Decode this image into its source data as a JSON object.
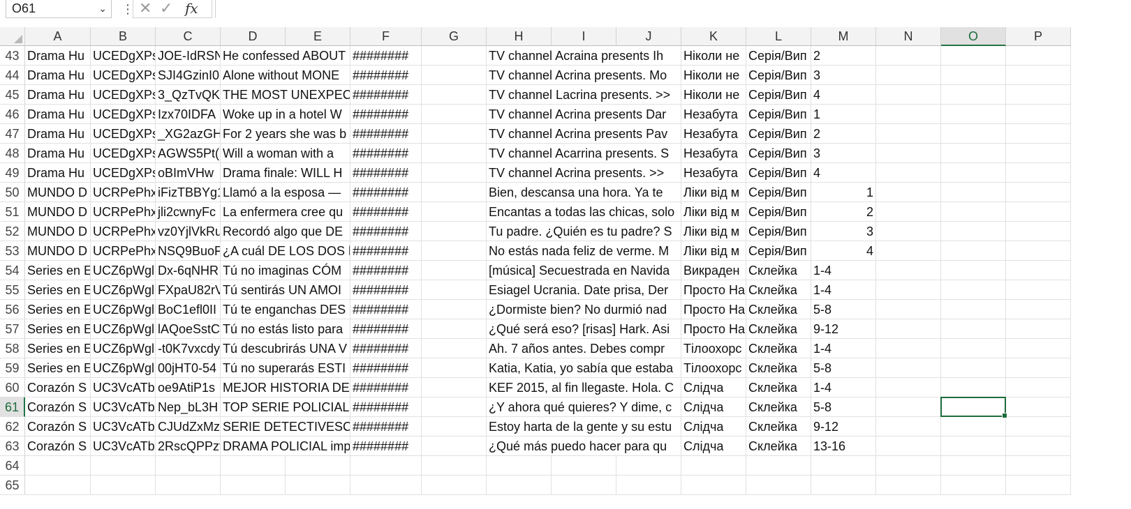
{
  "formula_bar": {
    "name_box": "O61",
    "more_icon": "⋮",
    "cancel_icon": "✕",
    "enter_icon": "✓",
    "fx_label": "fx",
    "formula": ""
  },
  "columns": [
    "A",
    "B",
    "C",
    "D",
    "E",
    "F",
    "G",
    "H",
    "I",
    "J",
    "K",
    "L",
    "M",
    "N",
    "O",
    "P"
  ],
  "active_column": "O",
  "active_row": "61",
  "rows": [
    {
      "n": "43",
      "cells": {
        "A": "Drama Hu",
        "B": "UCEDgXPs",
        "C": "JOE-IdRSN",
        "D": "He confessed ABOUT",
        "F": "########",
        "H": "TV channel Acraina presents Ih",
        "K": "Ніколи не",
        "L": "Серія/Вип",
        "M": "2"
      }
    },
    {
      "n": "44",
      "cells": {
        "A": "Drama Hu",
        "B": "UCEDgXPs",
        "C": "SJI4GzinI0",
        "D": "Alone without MONE",
        "F": "########",
        "H": "TV channel Acrina presents. Mo",
        "K": "Ніколи не",
        "L": "Серія/Вип",
        "M": "3"
      }
    },
    {
      "n": "45",
      "cells": {
        "A": "Drama Hu",
        "B": "UCEDgXPs",
        "C": "3_QzTvQK",
        "D": "THE MOST UNEXPECT",
        "F": "########",
        "H": "TV channel Lacrina presents. >>",
        "K": "Ніколи не",
        "L": "Серія/Вип",
        "M": "4"
      }
    },
    {
      "n": "46",
      "cells": {
        "A": "Drama Hu",
        "B": "UCEDgXPs",
        "C": "Izx70IDFA",
        "D": "Woke up in a hotel W",
        "F": "########",
        "H": "TV channel Acrina presents Dar",
        "K": "Незабута",
        "L": "Серія/Вип",
        "M": "1"
      }
    },
    {
      "n": "47",
      "cells": {
        "A": "Drama Hu",
        "B": "UCEDgXPs",
        "C": "_XG2azGH",
        "D": "For 2 years she was b",
        "F": "########",
        "H": "TV channel Acrina presents Pav",
        "K": "Незабута",
        "L": "Серія/Вип",
        "M": "2"
      }
    },
    {
      "n": "48",
      "cells": {
        "A": "Drama Hu",
        "B": "UCEDgXPs",
        "C": "AGWS5Pt(",
        "D": "Will a woman with a",
        "F": "########",
        "H": "TV channel Acarrina presents. S",
        "K": "Незабута",
        "L": "Серія/Вип",
        "M": "3"
      }
    },
    {
      "n": "49",
      "cells": {
        "A": "Drama Hu",
        "B": "UCEDgXPs",
        "C": "oBImVHw",
        "D": "Drama finale: WILL H",
        "F": "########",
        "H": "TV channel Acrina presents. >>",
        "K": "Незабута",
        "L": "Серія/Вип",
        "M": "4"
      }
    },
    {
      "n": "50",
      "cells": {
        "A": "MUNDO D",
        "B": "UCRPePhx",
        "C": "iFizTBBYg1",
        "D": "Llamó a la esposa —",
        "F": "########",
        "H": "Bien, descansa una hora. Ya te",
        "K": "Ліки від м",
        "L": "Серія/Вип",
        "M_num": "1"
      }
    },
    {
      "n": "51",
      "cells": {
        "A": "MUNDO D",
        "B": "UCRPePhx",
        "C": "jli2cwnyFc",
        "D": "La enfermera cree qu",
        "F": "########",
        "H": "Encantas a todas las chicas, solo",
        "K": "Ліки від м",
        "L": "Серія/Вип",
        "M_num": "2"
      }
    },
    {
      "n": "52",
      "cells": {
        "A": "MUNDO D",
        "B": "UCRPePhx",
        "C": "vz0YjlVkRu",
        "D": "Recordó algo que DE",
        "F": "########",
        "H": "Tu padre. ¿Quién es tu padre? S",
        "K": "Ліки від м",
        "L": "Серія/Вип",
        "M_num": "3"
      }
    },
    {
      "n": "53",
      "cells": {
        "A": "MUNDO D",
        "B": "UCRPePhx",
        "C": "NSQ9BuoF",
        "D": "¿A cuál DE LOS DOS h",
        "F": "########",
        "H": "No estás nada feliz de verme. M",
        "K": "Ліки від м",
        "L": "Серія/Вип",
        "M_num": "4"
      }
    },
    {
      "n": "54",
      "cells": {
        "A": "Series en E",
        "B": "UCZ6pWgl",
        "C": "Dx-6qNHR",
        "D": "Tú no imaginas CÓM",
        "F": "########",
        "H": "[música] Secuestrada en Navida",
        "K": "Викраден",
        "L": "Склейка",
        "M": "1-4"
      }
    },
    {
      "n": "55",
      "cells": {
        "A": "Series en E",
        "B": "UCZ6pWgl",
        "C": "FXpaU82rV",
        "D": "Tú sentirás UN AMOI",
        "F": "########",
        "H": "Esiagel Ucrania. Date prisa, Der",
        "K": "Просто На",
        "L": "Склейка",
        "M": "1-4"
      }
    },
    {
      "n": "56",
      "cells": {
        "A": "Series en E",
        "B": "UCZ6pWgl",
        "C": "BoC1efl0II",
        "D": "Tú te enganchas DES",
        "F": "########",
        "H": "¿Dormiste bien? No durmió nad",
        "K": "Просто На",
        "L": "Склейка",
        "M": "5-8"
      }
    },
    {
      "n": "57",
      "cells": {
        "A": "Series en E",
        "B": "UCZ6pWgl",
        "C": "lAQoeSstC",
        "D": "Tú no estás listo para",
        "F": "########",
        "H": "¿Qué será eso? [risas] Hark. Asi",
        "K": "Просто На",
        "L": "Склейка",
        "M": "9-12"
      }
    },
    {
      "n": "58",
      "cells": {
        "A": "Series en E",
        "B": "UCZ6pWgl",
        "C": "-t0K7vxcdy",
        "D": "Tú descubrirás UNA V",
        "F": "########",
        "H": "Ah. 7 años antes. Debes compr",
        "K": "Тілоохорс",
        "L": "Склейка",
        "M": "1-4"
      }
    },
    {
      "n": "59",
      "cells": {
        "A": "Series en E",
        "B": "UCZ6pWgl",
        "C": "00jHT0-54",
        "D": "Tú no superarás ESTI",
        "F": "########",
        "H": "Katia, Katia, yo sabía que estaba",
        "K": "Тілоохорс",
        "L": "Склейка",
        "M": "5-8"
      }
    },
    {
      "n": "60",
      "cells": {
        "A": "Corazón S",
        "B": "UC3VcATb",
        "C": "oe9AtiP1s",
        "D": "MEJOR HISTORIA DET",
        "F": "########",
        "H": "KEF 2015, al fin llegaste. Hola. C",
        "K": "Слідча",
        "L": "Склейка",
        "M": "1-4"
      }
    },
    {
      "n": "61",
      "cells": {
        "A": "Corazón S",
        "B": "UC3VcATb",
        "C": "Nep_bL3H",
        "D": "TOP SERIE POLICIAL c",
        "F": "########",
        "H": "¿Y ahora qué quieres? Y dime, c",
        "K": "Слідча",
        "L": "Склейка",
        "M": "5-8"
      }
    },
    {
      "n": "62",
      "cells": {
        "A": "Corazón S",
        "B": "UC3VcATb",
        "C": "CJUdZxMz",
        "D": "SERIE DETECTIVESCA",
        "F": "########",
        "H": "Estoy harta de la gente y su estu",
        "K": "Слідча",
        "L": "Склейка",
        "M": "9-12"
      }
    },
    {
      "n": "63",
      "cells": {
        "A": "Corazón S",
        "B": "UC3VcATb",
        "C": "2RscQPPzf",
        "D": "DRAMA POLICIAL imp",
        "F": "########",
        "H": "¿Qué más puedo hacer para qu",
        "K": "Слідча",
        "L": "Склейка",
        "M": "13-16"
      }
    },
    {
      "n": "64",
      "cells": {}
    },
    {
      "n": "65",
      "cells": {}
    }
  ],
  "colors": {
    "accent": "#217346",
    "selection": "#1e6b3c",
    "header_bg": "#f3f3f3",
    "gridline": "#e1e1e1"
  }
}
